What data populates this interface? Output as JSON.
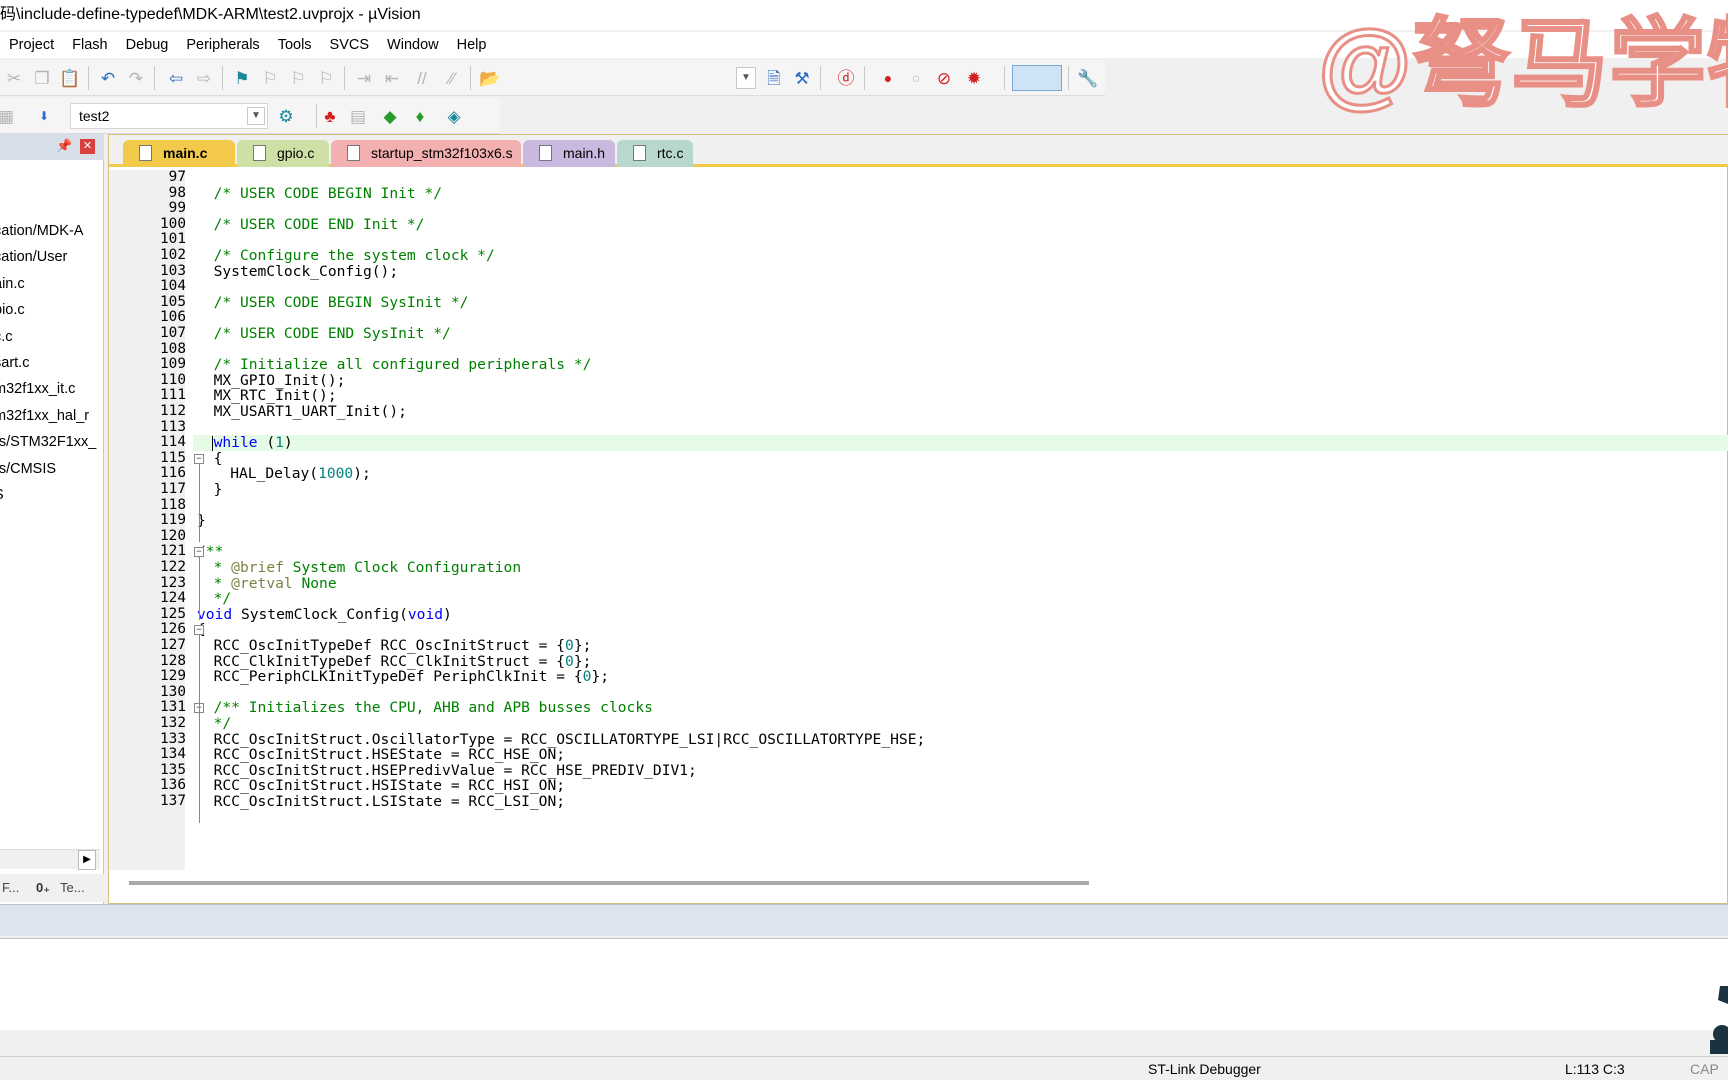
{
  "window": {
    "title": "码\\include-define-typedef\\MDK-ARM\\test2.uvprojx - µVision"
  },
  "menu": [
    "Project",
    "Flash",
    "Debug",
    "Peripherals",
    "Tools",
    "SVCS",
    "Window",
    "Help"
  ],
  "toolbar2": {
    "target": "test2"
  },
  "project_panel": {
    "tree": [
      "cation/MDK-A",
      "cation/User",
      "ain.c",
      "pio.c",
      "c.c",
      "sart.c",
      "m32f1xx_it.c",
      "m32f1xx_hal_r",
      "rs/STM32F1xx_",
      "rs/CMSIS",
      "S"
    ],
    "tab1": "F...",
    "tab2": "Te..."
  },
  "tabs": [
    "main.c",
    "gpio.c",
    "startup_stm32f103x6.s",
    "main.h",
    "rtc.c"
  ],
  "code": [
    {
      "n": "97",
      "indent": 0,
      "parts": []
    },
    {
      "n": "98",
      "indent": 1,
      "parts": [
        [
          "cm",
          "/* USER CODE BEGIN Init */"
        ]
      ]
    },
    {
      "n": "99",
      "indent": 0,
      "parts": []
    },
    {
      "n": "100",
      "indent": 1,
      "parts": [
        [
          "cm",
          "/* USER CODE END Init */"
        ]
      ]
    },
    {
      "n": "101",
      "indent": 0,
      "parts": []
    },
    {
      "n": "102",
      "indent": 1,
      "parts": [
        [
          "cm",
          "/* Configure the system clock */"
        ]
      ]
    },
    {
      "n": "103",
      "indent": 1,
      "parts": [
        [
          "",
          "SystemClock_Config();"
        ]
      ]
    },
    {
      "n": "104",
      "indent": 0,
      "parts": []
    },
    {
      "n": "105",
      "indent": 1,
      "parts": [
        [
          "cm",
          "/* USER CODE BEGIN SysInit */"
        ]
      ]
    },
    {
      "n": "106",
      "indent": 0,
      "parts": []
    },
    {
      "n": "107",
      "indent": 1,
      "parts": [
        [
          "cm",
          "/* USER CODE END SysInit */"
        ]
      ]
    },
    {
      "n": "108",
      "indent": 0,
      "parts": []
    },
    {
      "n": "109",
      "indent": 1,
      "parts": [
        [
          "cm",
          "/* Initialize all configured peripherals */"
        ]
      ]
    },
    {
      "n": "110",
      "indent": 1,
      "parts": [
        [
          "",
          "MX_GPIO_Init();"
        ]
      ]
    },
    {
      "n": "111",
      "indent": 1,
      "parts": [
        [
          "",
          "MX_RTC_Init();"
        ]
      ]
    },
    {
      "n": "112",
      "indent": 1,
      "parts": [
        [
          "",
          "MX_USART1_UART_Init();"
        ]
      ]
    },
    {
      "n": "113",
      "indent": 1,
      "parts": []
    },
    {
      "n": "114",
      "indent": 1,
      "parts": [
        [
          "kw",
          "while"
        ],
        [
          "",
          " ("
        ],
        [
          "num",
          "1"
        ],
        [
          "",
          ")"
        ]
      ]
    },
    {
      "n": "115",
      "indent": 1,
      "parts": [
        [
          "",
          "{"
        ]
      ]
    },
    {
      "n": "116",
      "indent": 2,
      "parts": [
        [
          "",
          "HAL_Delay("
        ],
        [
          "num",
          "1000"
        ],
        [
          "",
          ");"
        ]
      ]
    },
    {
      "n": "117",
      "indent": 1,
      "parts": [
        [
          "",
          "}"
        ]
      ]
    },
    {
      "n": "118",
      "indent": 0,
      "parts": []
    },
    {
      "n": "119",
      "indent": 0,
      "parts": [
        [
          "",
          "}"
        ]
      ]
    },
    {
      "n": "120",
      "indent": 0,
      "parts": []
    },
    {
      "n": "121",
      "indent": 0,
      "parts": [
        [
          "cm",
          "/**"
        ]
      ]
    },
    {
      "n": "122",
      "indent": 1,
      "parts": [
        [
          "cm",
          "* "
        ],
        [
          "dtag",
          "@brief"
        ],
        [
          "cm",
          " System Clock Configuration"
        ]
      ]
    },
    {
      "n": "123",
      "indent": 1,
      "parts": [
        [
          "cm",
          "* "
        ],
        [
          "dtag",
          "@retval"
        ],
        [
          "cm",
          " None"
        ]
      ]
    },
    {
      "n": "124",
      "indent": 1,
      "parts": [
        [
          "cm",
          "*/"
        ]
      ]
    },
    {
      "n": "125",
      "indent": 0,
      "parts": [
        [
          "kw",
          "void"
        ],
        [
          "",
          " SystemClock_Config("
        ],
        [
          "kw",
          "void"
        ],
        [
          "",
          ")"
        ]
      ]
    },
    {
      "n": "126",
      "indent": 0,
      "parts": [
        [
          "",
          "{"
        ]
      ]
    },
    {
      "n": "127",
      "indent": 1,
      "parts": [
        [
          "",
          "RCC_OscInitTypeDef RCC_OscInitStruct = {"
        ],
        [
          "num",
          "0"
        ],
        [
          "",
          "};"
        ]
      ]
    },
    {
      "n": "128",
      "indent": 1,
      "parts": [
        [
          "",
          "RCC_ClkInitTypeDef RCC_ClkInitStruct = {"
        ],
        [
          "num",
          "0"
        ],
        [
          "",
          "};"
        ]
      ]
    },
    {
      "n": "129",
      "indent": 1,
      "parts": [
        [
          "",
          "RCC_PeriphCLKInitTypeDef PeriphClkInit = {"
        ],
        [
          "num",
          "0"
        ],
        [
          "",
          "};"
        ]
      ]
    },
    {
      "n": "130",
      "indent": 0,
      "parts": []
    },
    {
      "n": "131",
      "indent": 1,
      "parts": [
        [
          "cm",
          "/** Initializes the CPU, AHB and APB busses clocks"
        ]
      ]
    },
    {
      "n": "132",
      "indent": 1,
      "parts": [
        [
          "cm",
          "*/"
        ]
      ]
    },
    {
      "n": "133",
      "indent": 1,
      "parts": [
        [
          "",
          "RCC_OscInitStruct.OscillatorType = RCC_OSCILLATORTYPE_LSI|RCC_OSCILLATORTYPE_HSE;"
        ]
      ]
    },
    {
      "n": "134",
      "indent": 1,
      "parts": [
        [
          "",
          "RCC_OscInitStruct.HSEState = RCC_HSE_ON;"
        ]
      ]
    },
    {
      "n": "135",
      "indent": 1,
      "parts": [
        [
          "",
          "RCC_OscInitStruct.HSEPredivValue = RCC_HSE_PREDIV_DIV1;"
        ]
      ]
    },
    {
      "n": "136",
      "indent": 1,
      "parts": [
        [
          "",
          "RCC_OscInitStruct.HSIState = RCC_HSI_ON;"
        ]
      ]
    },
    {
      "n": "137",
      "indent": 1,
      "parts": [
        [
          "",
          "RCC_OscInitStruct.LSIState = RCC_LSI_ON;"
        ]
      ]
    }
  ],
  "watermark": "@弩马学物",
  "status": {
    "debugger": "ST-Link Debugger",
    "position": "L:113 C:3",
    "caps": "CAP"
  },
  "colors": {
    "active_tab": "#f3c94a",
    "current_line": "#e6fbe6",
    "comment": "#008000",
    "keyword": "#0000ff",
    "number": "#008080"
  }
}
